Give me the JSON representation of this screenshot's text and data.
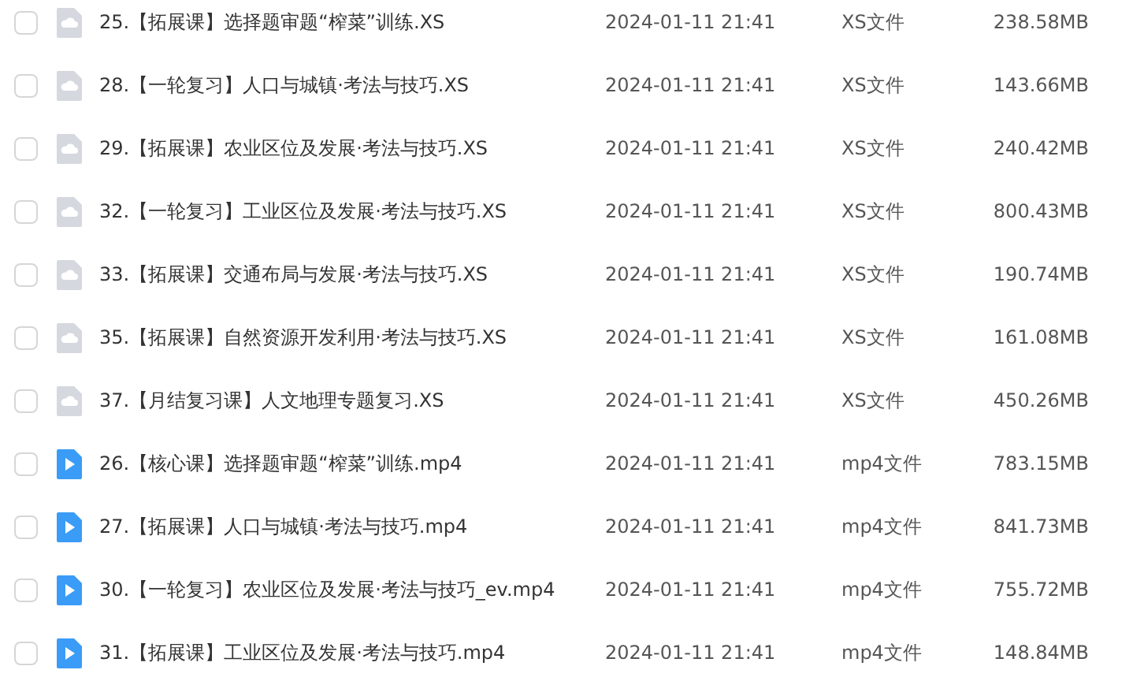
{
  "files": [
    {
      "kind": "doc",
      "checked": false,
      "name": "25.【拓展课】选择题审题“榨菜”训练.XS",
      "modified": "2024-01-11 21:41",
      "type": "XS文件",
      "size": "238.58MB"
    },
    {
      "kind": "doc",
      "checked": false,
      "name": "28.【一轮复习】人口与城镇·考法与技巧.XS",
      "modified": "2024-01-11 21:41",
      "type": "XS文件",
      "size": "143.66MB"
    },
    {
      "kind": "doc",
      "checked": false,
      "name": "29.【拓展课】农业区位及发展·考法与技巧.XS",
      "modified": "2024-01-11 21:41",
      "type": "XS文件",
      "size": "240.42MB"
    },
    {
      "kind": "doc",
      "checked": false,
      "name": "32.【一轮复习】工业区位及发展·考法与技巧.XS",
      "modified": "2024-01-11 21:41",
      "type": "XS文件",
      "size": "800.43MB"
    },
    {
      "kind": "doc",
      "checked": false,
      "name": "33.【拓展课】交通布局与发展·考法与技巧.XS",
      "modified": "2024-01-11 21:41",
      "type": "XS文件",
      "size": "190.74MB"
    },
    {
      "kind": "doc",
      "checked": false,
      "name": "35.【拓展课】自然资源开发利用·考法与技巧.XS",
      "modified": "2024-01-11 21:41",
      "type": "XS文件",
      "size": "161.08MB"
    },
    {
      "kind": "doc",
      "checked": false,
      "name": "37.【月结复习课】人文地理专题复习.XS",
      "modified": "2024-01-11 21:41",
      "type": "XS文件",
      "size": "450.26MB"
    },
    {
      "kind": "video",
      "checked": false,
      "name": "26.【核心课】选择题审题“榨菜”训练.mp4",
      "modified": "2024-01-11 21:41",
      "type": "mp4文件",
      "size": "783.15MB"
    },
    {
      "kind": "video",
      "checked": false,
      "name": "27.【拓展课】人口与城镇·考法与技巧.mp4",
      "modified": "2024-01-11 21:41",
      "type": "mp4文件",
      "size": "841.73MB"
    },
    {
      "kind": "video",
      "checked": false,
      "name": "30.【一轮复习】农业区位及发展·考法与技巧_ev.mp4",
      "modified": "2024-01-11 21:41",
      "type": "mp4文件",
      "size": "755.72MB"
    },
    {
      "kind": "video",
      "checked": false,
      "name": "31.【拓展课】工业区位及发展·考法与技巧.mp4",
      "modified": "2024-01-11 21:41",
      "type": "mp4文件",
      "size": "148.84MB"
    }
  ]
}
